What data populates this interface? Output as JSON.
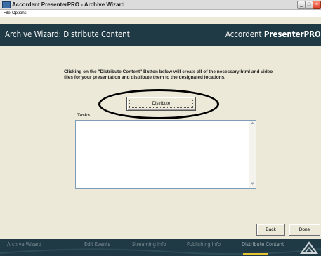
{
  "window": {
    "title": "Accordent PresenterPRO - Archive Wizard",
    "controls": {
      "minimize": "_",
      "maximize": "□",
      "close": "×"
    }
  },
  "menu": [
    "File",
    "Options"
  ],
  "header": {
    "title": "Archive Wizard: Distribute Content",
    "brand_regular": "Accordent ",
    "brand_bold": "PresenterPRO"
  },
  "content": {
    "instructions": "Clicking on the \"Distribute Content\" Button below will create all of the necessary html and video files for your presentation and distribute them to the designated locations.",
    "distribute_label": "Distribute",
    "tasks_label": "Tasks",
    "back_label": "Back",
    "done_label": "Done",
    "scroll_up": "▲",
    "scroll_down": "▼"
  },
  "steps": [
    {
      "label": "Archive Wizard"
    },
    {
      "label": "Edit Events"
    },
    {
      "label": "Streaming Info"
    },
    {
      "label": "Publishing Info"
    },
    {
      "label": "Distribute Content",
      "active": true
    }
  ],
  "colors": {
    "header_bg": "#1f3a45",
    "active_step_underline": "#e6c233"
  }
}
